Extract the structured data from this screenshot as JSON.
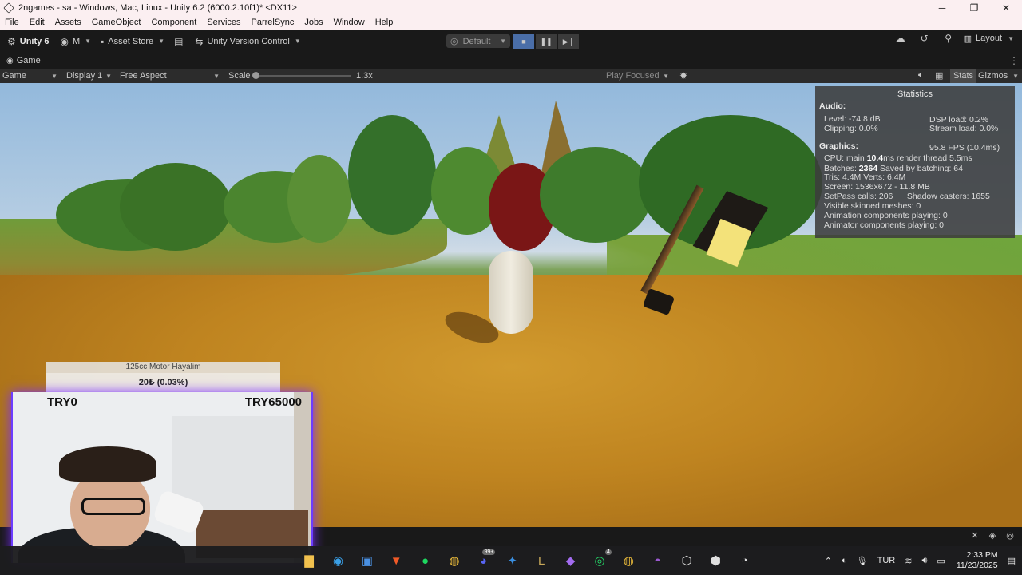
{
  "window": {
    "title": "2ngames - sa - Windows, Mac, Linux - Unity 6.2 (6000.2.10f1)* <DX11>"
  },
  "menu": [
    "File",
    "Edit",
    "Assets",
    "GameObject",
    "Component",
    "Services",
    "ParrelSync",
    "Jobs",
    "Window",
    "Help"
  ],
  "toolbar": {
    "unity_label": "Unity 6",
    "account_label": "M",
    "asset_store_label": "Asset Store",
    "version_control_label": "Unity Version Control",
    "layout_preset": "Default",
    "layout_label": "Layout"
  },
  "tab": {
    "label": "Game"
  },
  "gamebar": {
    "mode": "Game",
    "display": "Display 1",
    "aspect": "Free Aspect",
    "scale_label": "Scale",
    "scale_value": "1.3x",
    "scale_fraction": 0.0,
    "play_focused": "Play Focused",
    "stats_label": "Stats",
    "gizmos_label": "Gizmos"
  },
  "stats": {
    "title": "Statistics",
    "audio_heading": "Audio:",
    "level": "Level: -74.8 dB",
    "clipping": "Clipping: 0.0%",
    "dsp_load": "DSP load: 0.2%",
    "stream_load": "Stream load: 0.0%",
    "graphics_heading": "Graphics:",
    "fps": "95.8 FPS (10.4ms)",
    "cpu_prefix": "CPU: main ",
    "cpu_main": "10.4",
    "cpu_suffix": "ms  render thread 5.5ms",
    "batches_prefix": "Batches: ",
    "batches": "2364",
    "batches_suffix": "  Saved by batching: 64",
    "tris": "Tris: 4.4M  Verts: 6.4M",
    "screen": "Screen: 1536x672 - 11.8 MB",
    "setpass": "SetPass calls: 206      Shadow casters: 1655",
    "skinned": "Visible skinned meshes: 0",
    "animation": "Animation components playing: 0",
    "animator": "Animator components playing: 0"
  },
  "donation": {
    "title": "125cc Motor Hayalim",
    "progress": "20₺ (0.03%)",
    "min_label": "TRY0",
    "max_label": "TRY65000"
  },
  "taskbar": {
    "language": "TUR",
    "time": "2:33 PM",
    "date": "11/23/2025",
    "apps": [
      {
        "name": "file-explorer-icon",
        "glyph": "▇",
        "color": "#f2c14e"
      },
      {
        "name": "edge-icon",
        "glyph": "◉",
        "color": "#3aa0e8"
      },
      {
        "name": "store-icon",
        "glyph": "▣",
        "color": "#4a90e2"
      },
      {
        "name": "brave-icon",
        "glyph": "▼",
        "color": "#f05a28"
      },
      {
        "name": "spotify-icon",
        "glyph": "●",
        "color": "#1ed760"
      },
      {
        "name": "chrome-icon",
        "glyph": "◍",
        "color": "#e8b93a",
        "badge": ""
      },
      {
        "name": "discord-icon",
        "glyph": "◕",
        "color": "#5865f2",
        "badge": "99+"
      },
      {
        "name": "app-icon",
        "glyph": "✦",
        "color": "#3a8fe0"
      },
      {
        "name": "league-icon",
        "glyph": "L",
        "color": "#c8a85a"
      },
      {
        "name": "riot-icon",
        "glyph": "◆",
        "color": "#a36cf0"
      },
      {
        "name": "whatsapp-icon",
        "glyph": "◎",
        "color": "#25d366",
        "badge": "4"
      },
      {
        "name": "chrome-profile-icon",
        "glyph": "◍",
        "color": "#e8b93a",
        "badge": ""
      },
      {
        "name": "github-icon",
        "glyph": "◓",
        "color": "#9b59d0"
      },
      {
        "name": "unity-hub-icon",
        "glyph": "⬡",
        "color": "#e0e0e0"
      },
      {
        "name": "unity-editor-icon",
        "glyph": "⬢",
        "color": "#e0e0e0"
      },
      {
        "name": "obs-icon",
        "glyph": "◔",
        "color": "#e0e0e0"
      }
    ]
  },
  "colors": {
    "editor_bg": "#191919",
    "stats_bg": "#3c3c3c",
    "active_play": "#4a6ea8",
    "webcam_glow": "#7a2cff"
  }
}
